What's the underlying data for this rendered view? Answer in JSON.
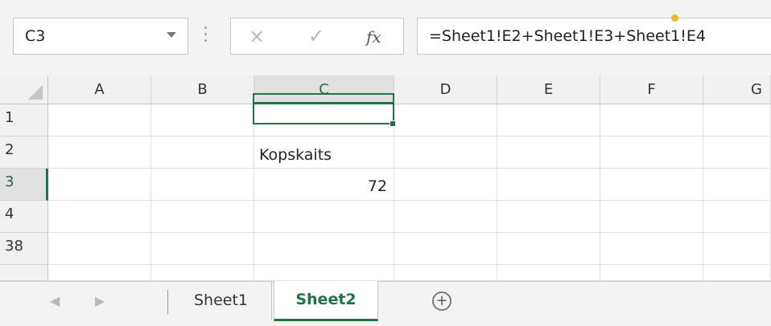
{
  "formula_bar": {
    "name_box": "C3",
    "cancel_icon": "×",
    "enter_icon": "✓",
    "fx_label": "fx",
    "formula": "=Sheet1!E2+Sheet1!E3+Sheet1!E4"
  },
  "grid": {
    "columns": [
      "A",
      "B",
      "C",
      "D",
      "E",
      "F",
      "G"
    ],
    "rows": [
      "1",
      "2",
      "3",
      "4",
      "38"
    ],
    "cells": {
      "C2": "Kopskaits",
      "C3": "72"
    },
    "selected_cell": "C3"
  },
  "sheet_tabs": {
    "prev": "◀",
    "next": "▶",
    "tabs": [
      "Sheet1",
      "Sheet2"
    ],
    "active": "Sheet2",
    "add_icon": "+"
  },
  "colors": {
    "accent": "#217346",
    "gridline": "#e1e1e1",
    "header_bg": "#f1f1f1"
  }
}
